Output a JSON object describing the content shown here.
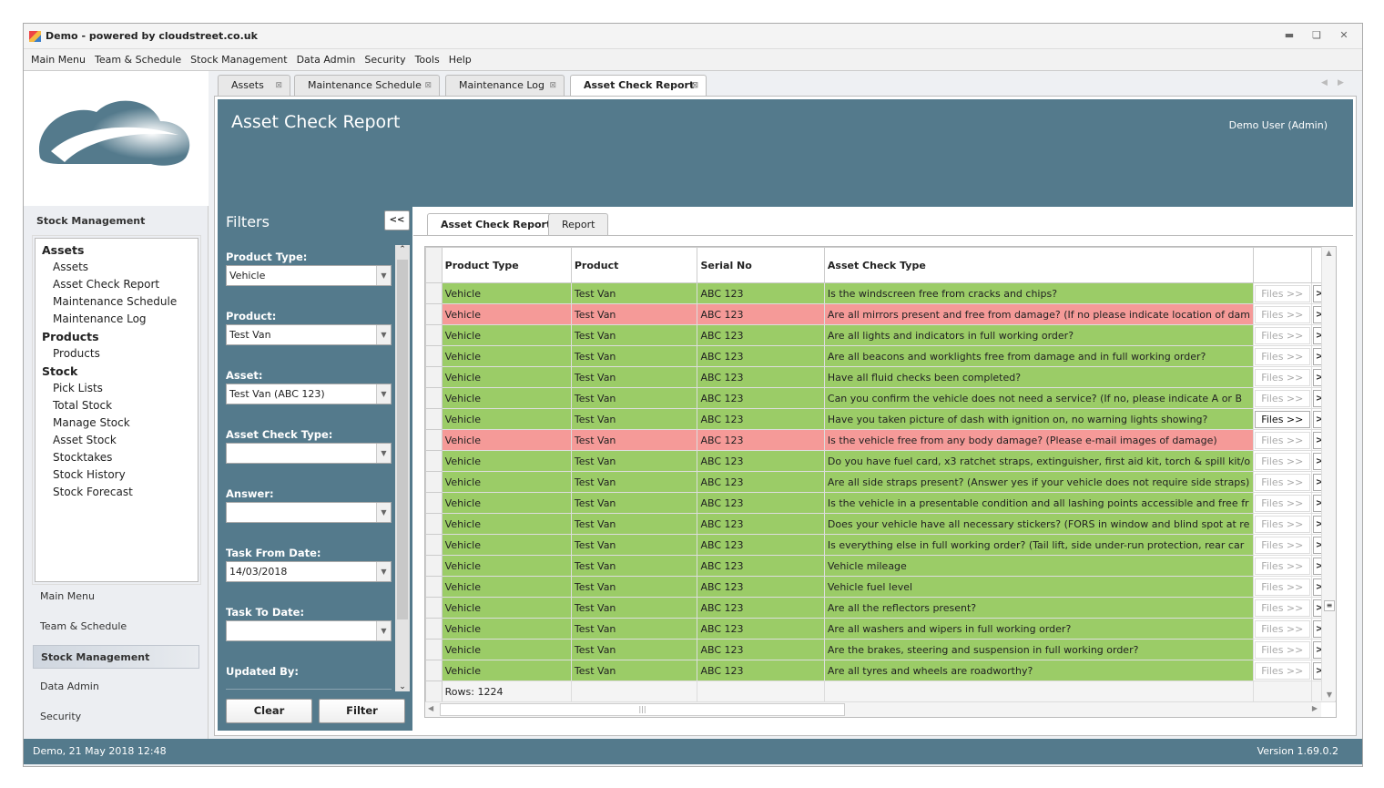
{
  "window": {
    "title": "Demo - powered by cloudstreet.co.uk",
    "controls": [
      "minimize",
      "restore",
      "close"
    ]
  },
  "menubar": [
    "Main Menu",
    "Team & Schedule",
    "Stock Management",
    "Data Admin",
    "Security",
    "Tools",
    "Help"
  ],
  "sidebar": {
    "heading": "Stock Management",
    "tree": [
      {
        "group": "Assets",
        "items": [
          "Assets",
          "Asset Check Report",
          "Maintenance Schedule",
          "Maintenance Log"
        ]
      },
      {
        "group": "Products",
        "items": [
          "Products"
        ]
      },
      {
        "group": "Stock",
        "items": [
          "Pick Lists",
          "Total Stock",
          "Manage Stock",
          "Asset Stock",
          "Stocktakes",
          "Stock History",
          "Stock Forecast"
        ]
      }
    ],
    "nav": [
      "Main Menu",
      "Team & Schedule",
      "Stock Management",
      "Data Admin",
      "Security"
    ],
    "nav_active": "Stock Management"
  },
  "tabs": [
    {
      "label": "Assets"
    },
    {
      "label": "Maintenance Schedule"
    },
    {
      "label": "Maintenance Log"
    },
    {
      "label": "Asset Check Report",
      "active": true
    }
  ],
  "page": {
    "title": "Asset Check Report",
    "user": "Demo User (Admin)"
  },
  "filters": {
    "title": "Filters",
    "collapse": "<<",
    "fields": [
      {
        "label": "Product Type:",
        "value": "Vehicle"
      },
      {
        "label": "Product:",
        "value": "Test Van"
      },
      {
        "label": "Asset:",
        "value": "Test Van (ABC 123)"
      },
      {
        "label": "Asset Check Type:",
        "value": ""
      },
      {
        "label": "Answer:",
        "value": ""
      },
      {
        "label": "Task From Date:",
        "value": "14/03/2018"
      },
      {
        "label": "Task To Date:",
        "value": ""
      },
      {
        "label": "Updated By:"
      }
    ],
    "clear": "Clear",
    "filter": "Filter"
  },
  "inner_tabs": [
    {
      "label": "Asset Check Report",
      "active": true
    },
    {
      "label": "Report"
    }
  ],
  "grid": {
    "columns": [
      "Product Type",
      "Product",
      "Serial No",
      "Asset Check Type"
    ],
    "files_label": "Files >>",
    "go_label": ">>",
    "colors": {
      "pass": "#9bcc67",
      "fail": "#f59a98"
    },
    "rows": [
      {
        "type": "Vehicle",
        "product": "Test Van",
        "serial": "ABC 123",
        "check": "Is the windscreen free from cracks and chips?",
        "status": "pass"
      },
      {
        "type": "Vehicle",
        "product": "Test Van",
        "serial": "ABC 123",
        "check": "Are all mirrors present and free from damage? (If no please indicate location of dam",
        "status": "fail"
      },
      {
        "type": "Vehicle",
        "product": "Test Van",
        "serial": "ABC 123",
        "check": "Are all lights and indicators in full working order?",
        "status": "pass"
      },
      {
        "type": "Vehicle",
        "product": "Test Van",
        "serial": "ABC 123",
        "check": "Are all beacons and worklights free from damage and in full working order?",
        "status": "pass"
      },
      {
        "type": "Vehicle",
        "product": "Test Van",
        "serial": "ABC 123",
        "check": "Have all fluid checks been completed?",
        "status": "pass"
      },
      {
        "type": "Vehicle",
        "product": "Test Van",
        "serial": "ABC 123",
        "check": "Can you confirm the vehicle does not need a service? (If no, please indicate A or B",
        "status": "pass"
      },
      {
        "type": "Vehicle",
        "product": "Test Van",
        "serial": "ABC 123",
        "check": "Have you taken picture of dash with ignition on, no warning lights showing?",
        "status": "pass",
        "files": true
      },
      {
        "type": "Vehicle",
        "product": "Test Van",
        "serial": "ABC 123",
        "check": "Is the vehicle free from any body damage? (Please e-mail images of damage)",
        "status": "fail"
      },
      {
        "type": "Vehicle",
        "product": "Test Van",
        "serial": "ABC 123",
        "check": "Do you have fuel card, x3 ratchet straps, extinguisher, first aid kit, torch & spill kit/o",
        "status": "pass"
      },
      {
        "type": "Vehicle",
        "product": "Test Van",
        "serial": "ABC 123",
        "check": "Are all side straps present? (Answer yes if your vehicle does not require side straps)",
        "status": "pass"
      },
      {
        "type": "Vehicle",
        "product": "Test Van",
        "serial": "ABC 123",
        "check": "Is the vehicle in a presentable condition and all lashing points accessible and free fr",
        "status": "pass"
      },
      {
        "type": "Vehicle",
        "product": "Test Van",
        "serial": "ABC 123",
        "check": "Does your vehicle have all necessary stickers? (FORS in window and blind spot at re",
        "status": "pass"
      },
      {
        "type": "Vehicle",
        "product": "Test Van",
        "serial": "ABC 123",
        "check": "Is everything else in full working order? (Tail lift, side under-run protection, rear car",
        "status": "pass"
      },
      {
        "type": "Vehicle",
        "product": "Test Van",
        "serial": "ABC 123",
        "check": "Vehicle mileage",
        "status": "pass"
      },
      {
        "type": "Vehicle",
        "product": "Test Van",
        "serial": "ABC 123",
        "check": "Vehicle fuel level",
        "status": "pass"
      },
      {
        "type": "Vehicle",
        "product": "Test Van",
        "serial": "ABC 123",
        "check": "Are all the reflectors present?",
        "status": "pass"
      },
      {
        "type": "Vehicle",
        "product": "Test Van",
        "serial": "ABC 123",
        "check": "Are all washers and wipers in full working order?",
        "status": "pass"
      },
      {
        "type": "Vehicle",
        "product": "Test Van",
        "serial": "ABC 123",
        "check": "Are the brakes, steering and suspension in full working order?",
        "status": "pass"
      },
      {
        "type": "Vehicle",
        "product": "Test Van",
        "serial": "ABC 123",
        "check": "Are all tyres and wheels are roadworthy?",
        "status": "pass"
      }
    ],
    "footer": "Rows: 1224"
  },
  "status": {
    "left": "Demo, 21 May 2018 12:48",
    "right": "Version 1.69.0.2"
  }
}
